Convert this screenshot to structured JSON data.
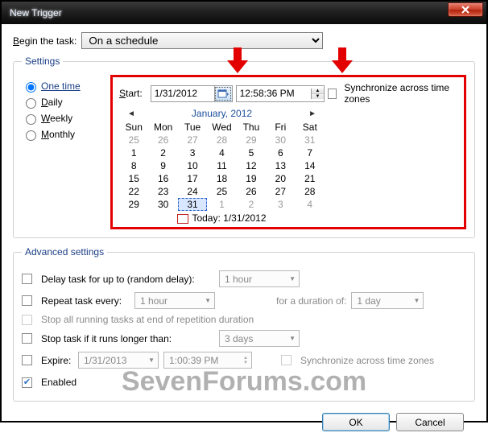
{
  "window": {
    "title": "New Trigger"
  },
  "begin": {
    "label": "Begin the task:",
    "value": "On a schedule"
  },
  "settings": {
    "legend": "Settings",
    "options": {
      "one_time": "One time",
      "daily": "Daily",
      "weekly": "Weekly",
      "monthly": "Monthly"
    },
    "start_label": "Start:",
    "date": "1/31/2012",
    "time": "12:58:36 PM",
    "sync_label": "Synchronize across time zones"
  },
  "calendar": {
    "month_label": "January, 2012",
    "day_headers": [
      "Sun",
      "Mon",
      "Tue",
      "Wed",
      "Thu",
      "Fri",
      "Sat"
    ],
    "grid": [
      {
        "d": "25",
        "o": true
      },
      {
        "d": "26",
        "o": true
      },
      {
        "d": "27",
        "o": true
      },
      {
        "d": "28",
        "o": true
      },
      {
        "d": "29",
        "o": true
      },
      {
        "d": "30",
        "o": true
      },
      {
        "d": "31",
        "o": true
      },
      {
        "d": "1"
      },
      {
        "d": "2"
      },
      {
        "d": "3"
      },
      {
        "d": "4"
      },
      {
        "d": "5"
      },
      {
        "d": "6"
      },
      {
        "d": "7"
      },
      {
        "d": "8"
      },
      {
        "d": "9"
      },
      {
        "d": "10"
      },
      {
        "d": "11"
      },
      {
        "d": "12"
      },
      {
        "d": "13"
      },
      {
        "d": "14"
      },
      {
        "d": "15"
      },
      {
        "d": "16"
      },
      {
        "d": "17"
      },
      {
        "d": "18"
      },
      {
        "d": "19"
      },
      {
        "d": "20"
      },
      {
        "d": "21"
      },
      {
        "d": "22"
      },
      {
        "d": "23"
      },
      {
        "d": "24"
      },
      {
        "d": "25"
      },
      {
        "d": "26"
      },
      {
        "d": "27"
      },
      {
        "d": "28"
      },
      {
        "d": "29"
      },
      {
        "d": "30"
      },
      {
        "d": "31",
        "sel": true
      },
      {
        "d": "1",
        "o": true
      },
      {
        "d": "2",
        "o": true
      },
      {
        "d": "3",
        "o": true
      },
      {
        "d": "4",
        "o": true
      }
    ],
    "today_label": "Today: 1/31/2012"
  },
  "advanced": {
    "legend": "Advanced settings",
    "delay_label": "Delay task for up to (random delay):",
    "delay_value": "1 hour",
    "repeat_label": "Repeat task every:",
    "repeat_value": "1 hour",
    "duration_label": "for a duration of:",
    "duration_value": "1 day",
    "stop_all_label": "Stop all running tasks at end of repetition duration",
    "stop_if_label": "Stop task if it runs longer than:",
    "stop_if_value": "3 days",
    "expire_label": "Expire:",
    "expire_date": "1/31/2013",
    "expire_time": "1:00:39 PM",
    "expire_sync_label": "Synchronize across time zones",
    "enabled_label": "Enabled"
  },
  "footer": {
    "ok": "OK",
    "cancel": "Cancel"
  },
  "watermark": "SevenForums.com"
}
